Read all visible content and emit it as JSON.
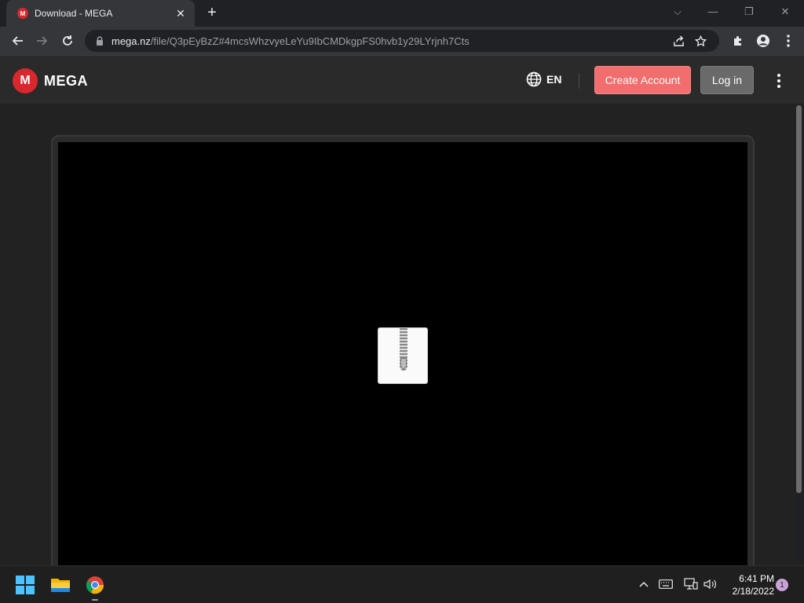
{
  "browser": {
    "tab": {
      "title": "Download - MEGA",
      "favicon_letter": "M"
    },
    "address": {
      "host": "mega.nz",
      "path": "/file/Q3pEyBzZ#4mcsWhzvyeLeYu9IbCMDkgpFS0hvb1y29LYrjnh7Cts"
    }
  },
  "mega": {
    "logo_letter": "M",
    "logo_text": "MEGA",
    "language": "EN",
    "create_account": "Create Account",
    "login": "Log in"
  },
  "taskbar": {
    "time": "6:41 PM",
    "date": "2/18/2022",
    "notification_count": "1"
  }
}
